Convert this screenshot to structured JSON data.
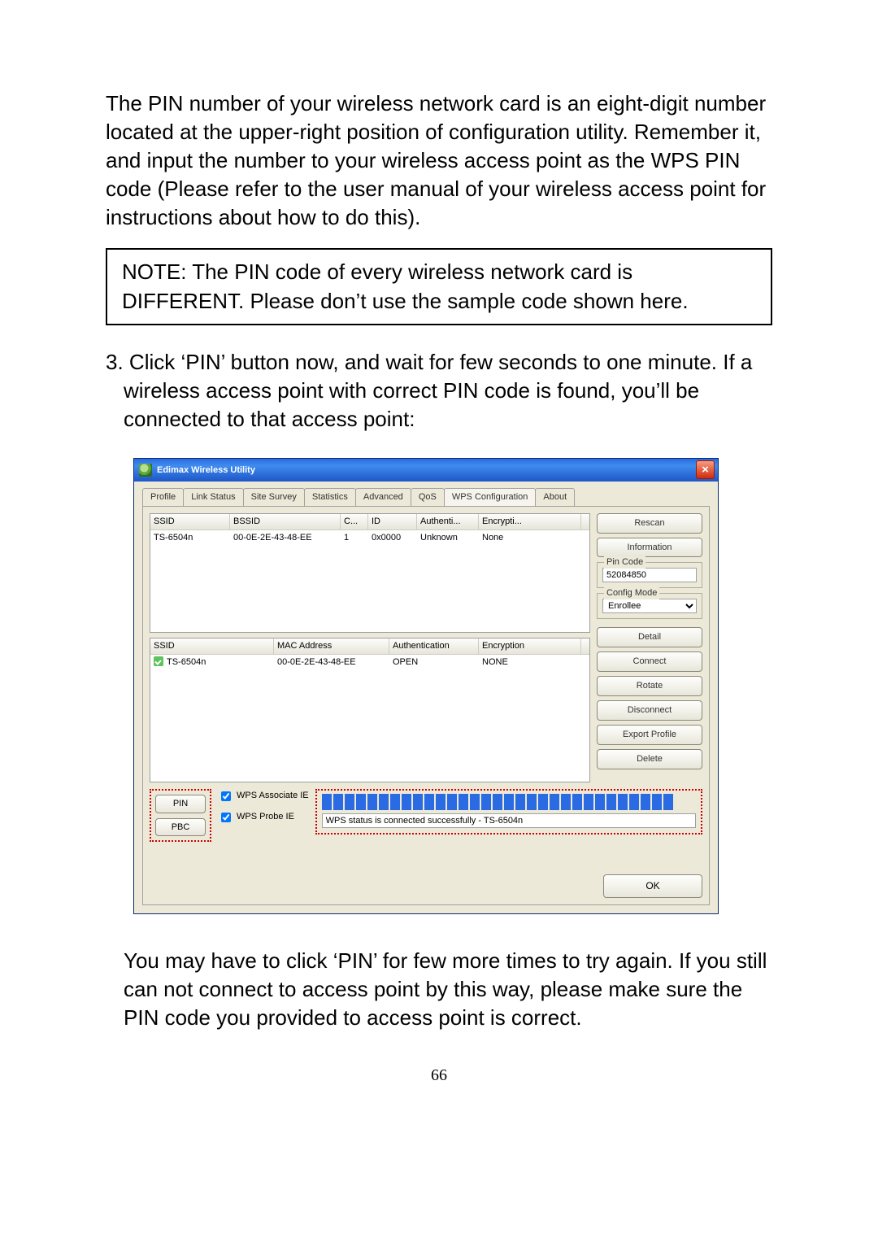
{
  "text": {
    "intro": "The PIN number of your wireless network card is an eight-digit number located at the upper-right position of configuration utility. Remember it, and input the number to your wireless access point as the WPS PIN code (Please refer to the user manual of your wireless access point for instructions about how to do this).",
    "note": "NOTE: The PIN code of every wireless network card is DIFFERENT. Please don’t use the sample code shown here.",
    "step3_prefix": "3. ",
    "step3": "Click ‘PIN’ button now, and wait for few seconds to one minute. If a wireless access point with correct PIN code is found, you’ll be connected to that access point:",
    "outro": "You may have to click ‘PIN’ for few more times to try again. If you still can not connect to access point by this way, please make sure the PIN code you provided to access point is correct.",
    "page_number": "66"
  },
  "window": {
    "title": "Edimax Wireless Utility",
    "tabs": [
      "Profile",
      "Link Status",
      "Site Survey",
      "Statistics",
      "Advanced",
      "QoS",
      "WPS Configuration",
      "About"
    ],
    "active_tab": "WPS Configuration",
    "list1": {
      "headers": [
        "SSID",
        "BSSID",
        "C...",
        "ID",
        "Authenti...",
        "Encrypti..."
      ],
      "row": [
        "TS-6504n",
        "00-0E-2E-43-48-EE",
        "1",
        "0x0000",
        "Unknown",
        "None"
      ]
    },
    "list2": {
      "headers": [
        "SSID",
        "MAC Address",
        "Authentication",
        "Encryption"
      ],
      "row": [
        "TS-6504n",
        "00-0E-2E-43-48-EE",
        "OPEN",
        "NONE"
      ]
    },
    "side_buttons": {
      "rescan": "Rescan",
      "information": "Information",
      "detail": "Detail",
      "connect": "Connect",
      "rotate": "Rotate",
      "disconnect": "Disconnect",
      "export_profile": "Export Profile",
      "delete": "Delete"
    },
    "pin_code_label": "Pin Code",
    "pin_code_value": "52084850",
    "config_mode_label": "Config Mode",
    "config_mode_value": "Enrollee",
    "pin_btn": "PIN",
    "pbc_btn": "PBC",
    "associate_label": "WPS Associate IE",
    "probe_label": "WPS Probe IE",
    "status_text": "WPS status is connected successfully - TS-6504n",
    "ok": "OK"
  }
}
